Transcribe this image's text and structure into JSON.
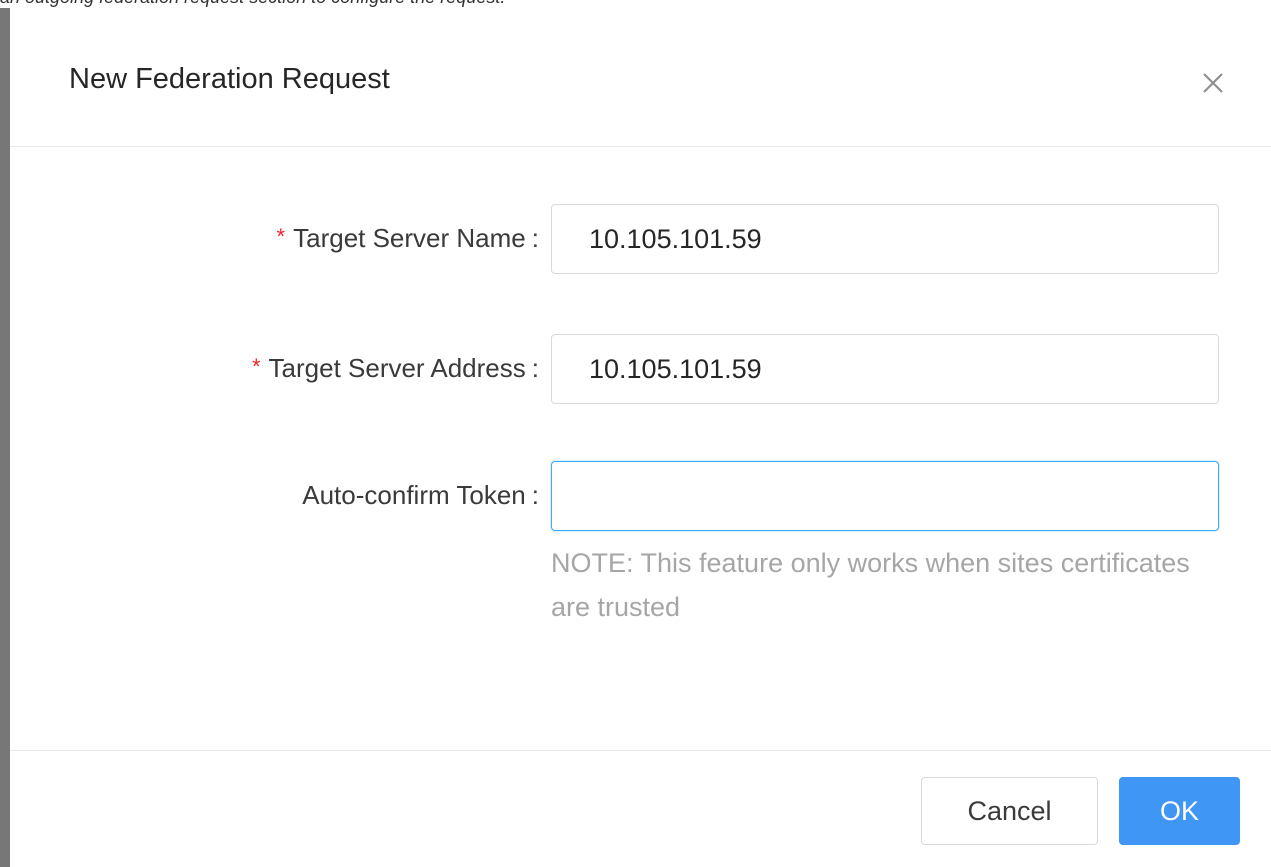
{
  "backdrop": {
    "top_text": "an outgoing federation request section to configure the request."
  },
  "modal": {
    "title": "New Federation Request",
    "close_icon": "close-icon"
  },
  "form": {
    "target_server_name": {
      "label": "Target Server Name",
      "required": true,
      "value": "10.105.101.59"
    },
    "target_server_address": {
      "label": "Target Server Address",
      "required": true,
      "value": "10.105.101.59"
    },
    "auto_confirm_token": {
      "label": "Auto-confirm Token",
      "required": false,
      "value": "",
      "note": "NOTE: This feature only works when sites certificates are trusted"
    },
    "required_marker": "*",
    "colon": ":"
  },
  "footer": {
    "cancel_label": "Cancel",
    "ok_label": "OK"
  },
  "colors": {
    "primary": "#4096f5",
    "required": "#f5222d",
    "focus_border": "#40a9ff",
    "note_text": "#a6a6a6"
  }
}
